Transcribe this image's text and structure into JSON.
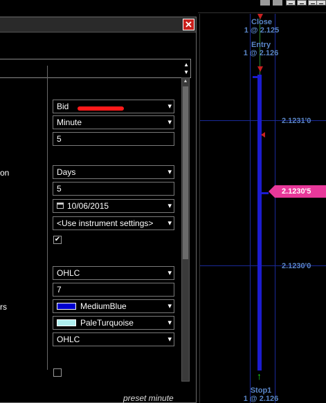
{
  "chart": {
    "price_labels": [
      "2.1231'0",
      "2.1230'0"
    ],
    "current_price": "2.1230'5",
    "orders": [
      {
        "name": "Close",
        "detail": "1 @ 2.125"
      },
      {
        "name": "Entry",
        "detail": "1 @ 2.126"
      },
      {
        "name": "Stop1",
        "detail": "1 @ 2.126"
      }
    ],
    "colors": {
      "grid": "#1a2a9a",
      "bar": "#1c1cd0",
      "price_tag": "#e8389a",
      "label": "#5a86c8"
    }
  },
  "dialog": {
    "left_labels": [
      "on",
      "rs"
    ],
    "fields": {
      "price_based_on": "Bid",
      "type": "Minute",
      "value": "5",
      "load_by": "Days",
      "days_to_load": "5",
      "end_date": "10/06/2015",
      "trading_hours": "<Use instrument settings>",
      "chart_style": "OHLC",
      "bar_width": "7",
      "color_up": "MediumBlue",
      "color_down": "PaleTurquoise",
      "style_type": "OHLC"
    },
    "colors": {
      "medium_blue": "#0000cd",
      "pale_turquoise": "#afeeee"
    },
    "checkbox1_checked": true,
    "checkbox2_checked": false,
    "preset_text": "preset minute"
  }
}
